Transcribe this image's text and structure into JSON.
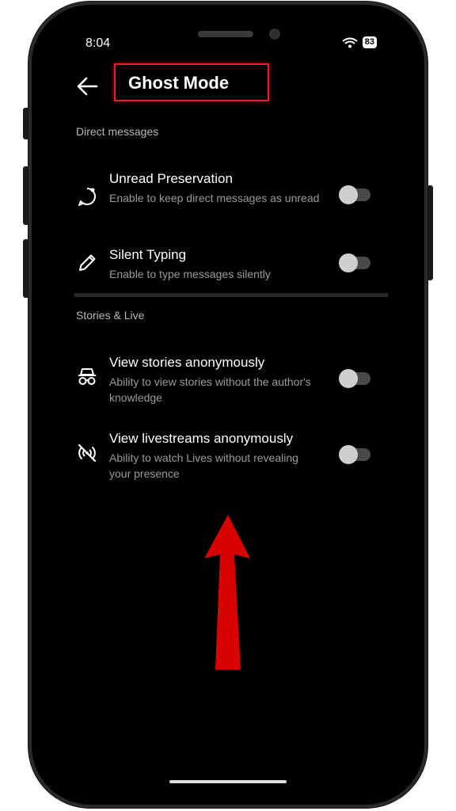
{
  "status": {
    "time": "8:04",
    "battery": "83"
  },
  "header": {
    "title": "Ghost Mode"
  },
  "sections": [
    {
      "title": "Direct messages",
      "items": [
        {
          "title": "Unread Preservation",
          "subtitle": "Enable to keep direct messages as unread",
          "icon": "chat-bubble-icon",
          "enabled": false
        },
        {
          "title": "Silent Typing",
          "subtitle": "Enable to type messages silently",
          "icon": "pencil-icon",
          "enabled": false
        }
      ]
    },
    {
      "title": "Stories & Live",
      "items": [
        {
          "title": "View stories anonymously",
          "subtitle": "Ability to view stories without the author's knowledge",
          "icon": "incognito-icon",
          "enabled": false
        },
        {
          "title": "View livestreams anonymously",
          "subtitle": "Ability to watch Lives without revealing your presence",
          "icon": "live-off-icon",
          "enabled": false
        }
      ]
    }
  ],
  "colors": {
    "highlight": "#e0202a",
    "arrow": "#d90000",
    "background": "#000000"
  }
}
